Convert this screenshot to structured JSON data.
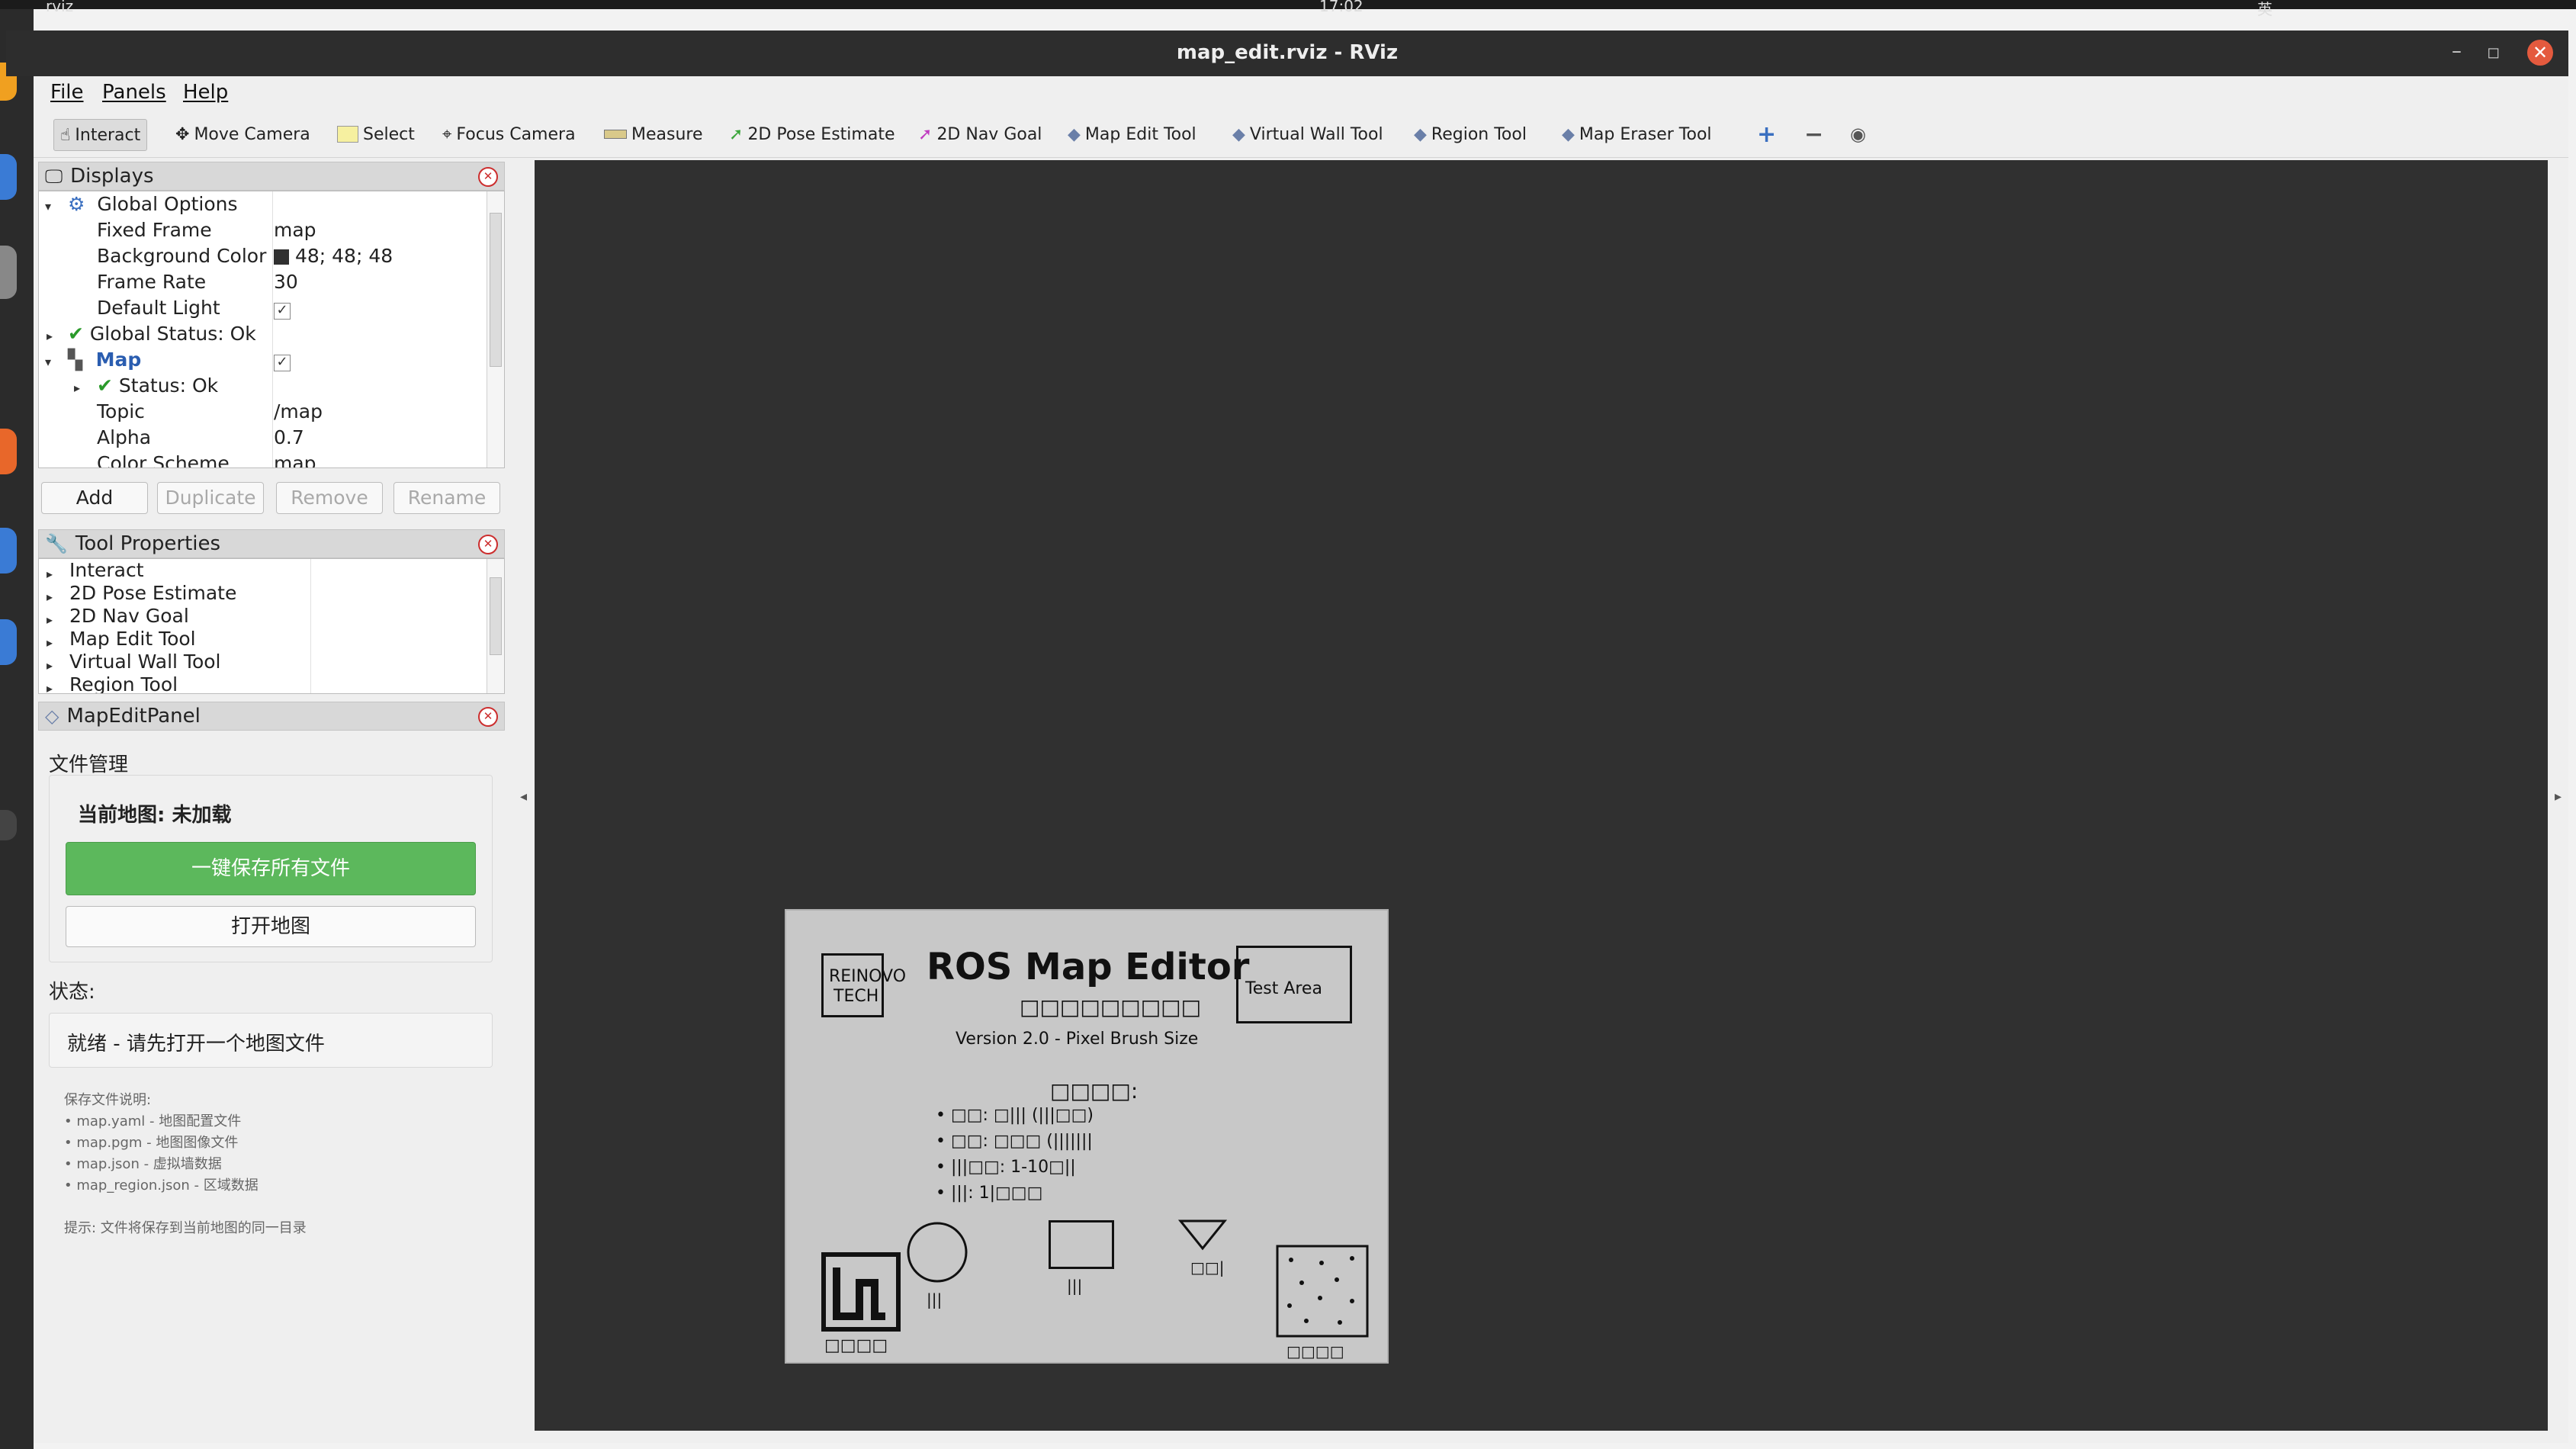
{
  "system": {
    "app_menu": "rviz",
    "clock": "17:02",
    "input_method": "英"
  },
  "window": {
    "title": "map_edit.rviz - RViz"
  },
  "menubar": {
    "file": "File",
    "panels": "Panels",
    "help": "Help"
  },
  "toolbar": {
    "interact": "Interact",
    "move_camera": "Move Camera",
    "select": "Select",
    "focus_camera": "Focus Camera",
    "measure": "Measure",
    "pose_estimate": "2D Pose Estimate",
    "nav_goal": "2D Nav Goal",
    "map_edit_tool": "Map Edit Tool",
    "virtual_wall_tool": "Virtual Wall Tool",
    "region_tool": "Region Tool",
    "map_eraser_tool": "Map Eraser Tool",
    "plus_icon": "+",
    "minus_icon": "−"
  },
  "displays": {
    "title": "Displays",
    "global_options": "Global Options",
    "fixed_frame_label": "Fixed Frame",
    "fixed_frame_value": "map",
    "bg_color_label": "Background Color",
    "bg_color_value": "48; 48; 48",
    "bg_color_swatch": "#303030",
    "frame_rate_label": "Frame Rate",
    "frame_rate_value": "30",
    "default_light_label": "Default Light",
    "default_light_value": "✓",
    "global_status": "Global Status: Ok",
    "map_label": "Map",
    "map_checked": "✓",
    "map_status": "Status: Ok",
    "topic_label": "Topic",
    "topic_value": "/map",
    "alpha_label": "Alpha",
    "alpha_value": "0.7",
    "color_scheme_label": "Color Scheme",
    "color_scheme_value": "map",
    "add": "Add",
    "duplicate": "Duplicate",
    "remove": "Remove",
    "rename": "Rename"
  },
  "tool_properties": {
    "title": "Tool Properties",
    "items": [
      "Interact",
      "2D Pose Estimate",
      "2D Nav Goal",
      "Map Edit Tool",
      "Virtual Wall Tool",
      "Region Tool"
    ]
  },
  "map_edit_panel": {
    "title": "MapEditPanel",
    "file_mgmt": "文件管理",
    "current_map": "当前地图: 未加载",
    "save_all": "一键保存所有文件",
    "open_map": "打开地图",
    "status_label": "状态:",
    "status_value": "就绪 - 请先打开一个地图文件",
    "notes_title": "保存文件说明:",
    "notes": [
      "• map.yaml - 地图配置文件",
      "• map.pgm - 地图图像文件",
      "• map.json - 虚拟墙数据",
      "• map_region.json - 区域数据"
    ],
    "hint": "提示: 文件将保存到当前地图的同一目录",
    "save_color": "#5cb85c"
  },
  "map_image": {
    "logo_line1": "REINOVO",
    "logo_line2": "TECH",
    "heading": "ROS Map Editor",
    "subheading": "□□□□□□□□□",
    "version": "Version 2.0 - Pixel Brush Size",
    "test_area": "Test Area",
    "features_title": "□□□□:",
    "features": [
      "• □□: □||| (|||□□)",
      "• □□: □□□ (|||||||",
      "• |||□□: 1-10□||",
      "• |||: 1|□□□"
    ],
    "label_bottom_left": "□□□□",
    "label_circle": "|||",
    "label_rect": "|||",
    "label_triangle": "□□|",
    "label_dots": "□□□□"
  }
}
